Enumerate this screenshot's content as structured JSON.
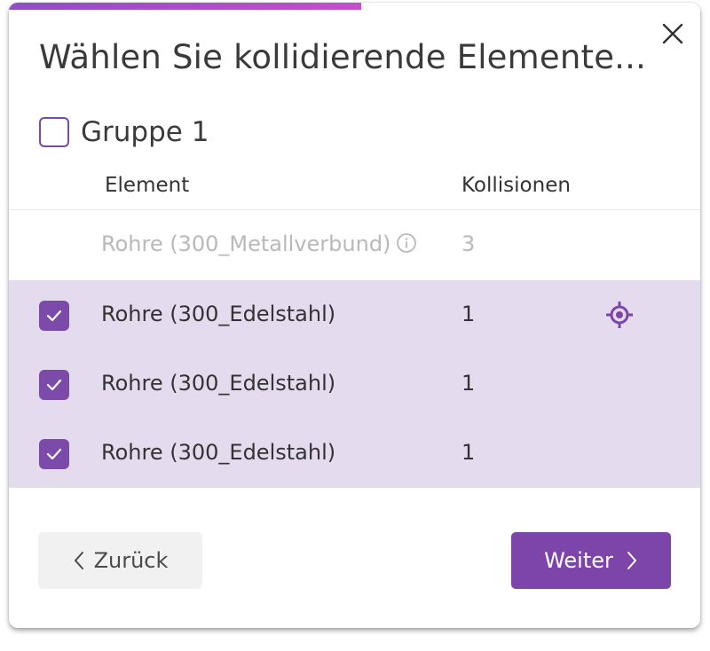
{
  "dialog": {
    "title": "Wählen Sie kollidierende Elemente...",
    "progress_fraction": 0.51,
    "progress_color": "#a64ec8",
    "close_icon": "close-icon"
  },
  "group": {
    "label": "Gruppe 1",
    "checked": false
  },
  "table": {
    "columns": [
      "Element",
      "Kollisionen"
    ],
    "rows": [
      {
        "name": "Rohre (300_Metallverbund)",
        "count": "3",
        "checked": false,
        "disabled": true,
        "info_icon": true
      },
      {
        "name": "Rohre (300_Edelstahl)",
        "count": "1",
        "checked": true,
        "disabled": false,
        "locate_icon": true
      },
      {
        "name": "Rohre (300_Edelstahl)",
        "count": "1",
        "checked": true,
        "disabled": false
      },
      {
        "name": "Rohre (300_Edelstahl)",
        "count": "1",
        "checked": true,
        "disabled": false
      }
    ]
  },
  "buttons": {
    "back_label": "Zurück",
    "next_label": "Weiter"
  },
  "colors": {
    "accent": "#7d45a9",
    "selected_row": "#e4dbee"
  }
}
